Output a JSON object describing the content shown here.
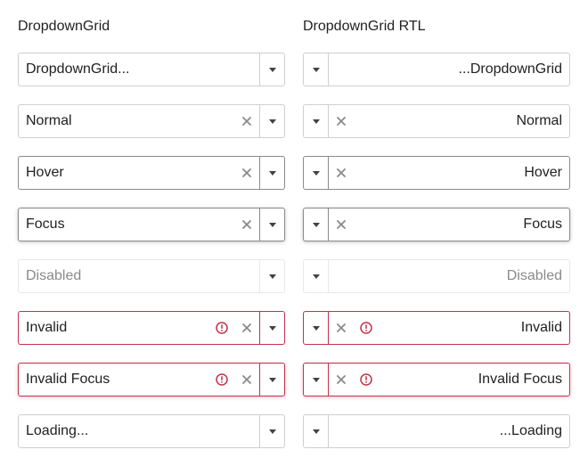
{
  "columns": {
    "ltr_title": "DropdownGrid",
    "rtl_title": "DropdownGrid RTL"
  },
  "rows": [
    {
      "state": "placeholder",
      "ltr_text": "DropdownGrid...",
      "rtl_text": "...DropdownGrid"
    },
    {
      "state": "normal",
      "ltr_text": "Normal",
      "rtl_text": "Normal"
    },
    {
      "state": "hover",
      "ltr_text": "Hover",
      "rtl_text": "Hover"
    },
    {
      "state": "focus",
      "ltr_text": "Focus",
      "rtl_text": "Focus"
    },
    {
      "state": "disabled",
      "ltr_text": "Disabled",
      "rtl_text": "Disabled"
    },
    {
      "state": "invalid",
      "ltr_text": "Invalid",
      "rtl_text": "Invalid"
    },
    {
      "state": "invalid-focus",
      "ltr_text": "Invalid Focus",
      "rtl_text": "Invalid Focus"
    },
    {
      "state": "loading",
      "ltr_text": "Loading...",
      "rtl_text": "...Loading"
    }
  ],
  "icons": {
    "dropdown": "chevron-down-icon",
    "clear": "close-icon",
    "error": "error-icon"
  },
  "colors": {
    "border": "#cfcfcf",
    "border_hover": "#8a8a8a",
    "invalid": "#c4314b",
    "text": "#212121",
    "muted": "#8a8a8a"
  }
}
